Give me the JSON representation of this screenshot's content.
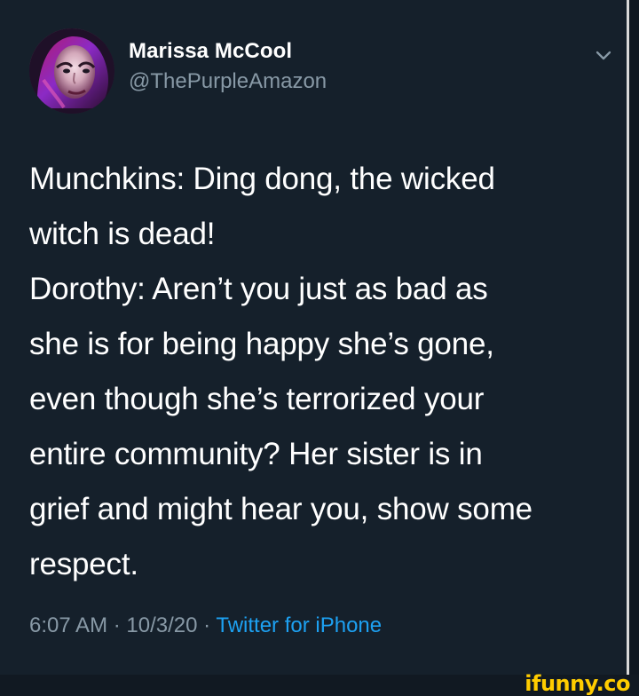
{
  "tweet": {
    "user": {
      "display_name": "Marissa McCool",
      "handle": "@ThePurpleAmazon"
    },
    "text": "Munchkins: Ding dong, the wicked\nwitch is dead!\nDorothy: Aren’t you just as bad as\nshe is for being happy she’s gone,\neven though she’s terrorized your\nentire community? Her sister is in\ngrief and might hear you, show some\nrespect.",
    "meta": {
      "time": "6:07 AM",
      "separator_1": " · ",
      "date": "10/3/20",
      "separator_2": " · ",
      "source": "Twitter for iPhone"
    },
    "icons": {
      "avatar": "profile-avatar",
      "menu": "chevron-down-icon"
    }
  },
  "watermark": {
    "text": "ifunny.co"
  },
  "colors": {
    "background": "#15202b",
    "text_primary": "#ffffff",
    "text_secondary": "#8899a6",
    "link": "#1da1f2",
    "watermark": "#ffcc00"
  }
}
